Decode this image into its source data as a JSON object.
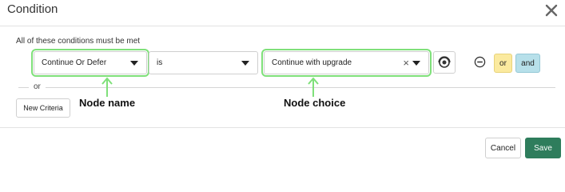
{
  "dialog": {
    "title": "Condition",
    "close_icon": "close-icon"
  },
  "rule": {
    "description": "All of these conditions must be met",
    "node_select": "Continue Or Defer",
    "operator_select": "is",
    "value_select": "Continue with upgrade",
    "clear_icon": "×",
    "remove_icon": "minus-circle-icon",
    "or_label": "or",
    "and_label": "and"
  },
  "divider": {
    "or_text": "or"
  },
  "new_criteria_label": "New Criteria",
  "annotations": {
    "node_name": "Node name",
    "node_choice": "Node choice"
  },
  "footer": {
    "cancel_label": "Cancel",
    "save_label": "Save"
  },
  "colors": {
    "highlight": "#7fe07a",
    "or_pill": "#fbea9f",
    "and_pill": "#b7e0ea",
    "save_button": "#2e7d5c"
  }
}
